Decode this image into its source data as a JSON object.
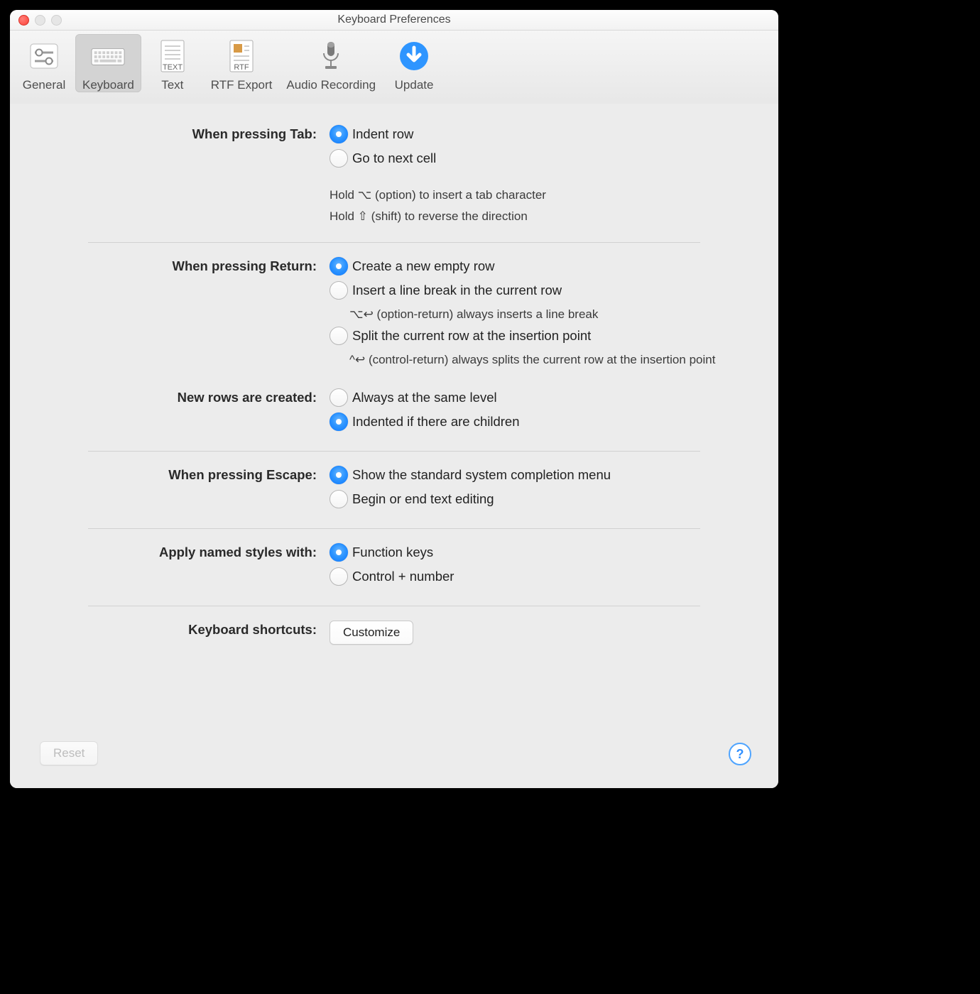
{
  "window": {
    "title": "Keyboard Preferences"
  },
  "toolbar": {
    "items": [
      {
        "label": "General"
      },
      {
        "label": "Keyboard",
        "selected": true
      },
      {
        "label": "Text"
      },
      {
        "label": "RTF Export"
      },
      {
        "label": "Audio Recording"
      },
      {
        "label": "Update"
      }
    ]
  },
  "sections": {
    "tab": {
      "label": "When pressing Tab:",
      "options": [
        "Indent row",
        "Go to next cell"
      ],
      "selected": 0,
      "hints": [
        "Hold ⌥ (option) to insert a tab character",
        "Hold ⇧ (shift) to reverse the direction"
      ]
    },
    "return": {
      "label": "When pressing Return:",
      "options": [
        "Create a new empty row",
        "Insert a line break in the current row",
        "Split the current row at the insertion point"
      ],
      "selected": 0,
      "hints": [
        "⌥↩ (option-return) always inserts a line break",
        "^↩ (control-return) always splits the current row at the insertion point"
      ]
    },
    "newrows": {
      "label": "New rows are created:",
      "options": [
        "Always at the same level",
        "Indented if there are children"
      ],
      "selected": 1
    },
    "escape": {
      "label": "When pressing Escape:",
      "options": [
        "Show the standard system completion menu",
        "Begin or end text editing"
      ],
      "selected": 0
    },
    "styles": {
      "label": "Apply named styles with:",
      "options": [
        "Function keys",
        "Control + number"
      ],
      "selected": 0
    },
    "shortcuts": {
      "label": "Keyboard shortcuts:",
      "button": "Customize"
    }
  },
  "footer": {
    "reset": "Reset",
    "help": "?"
  }
}
